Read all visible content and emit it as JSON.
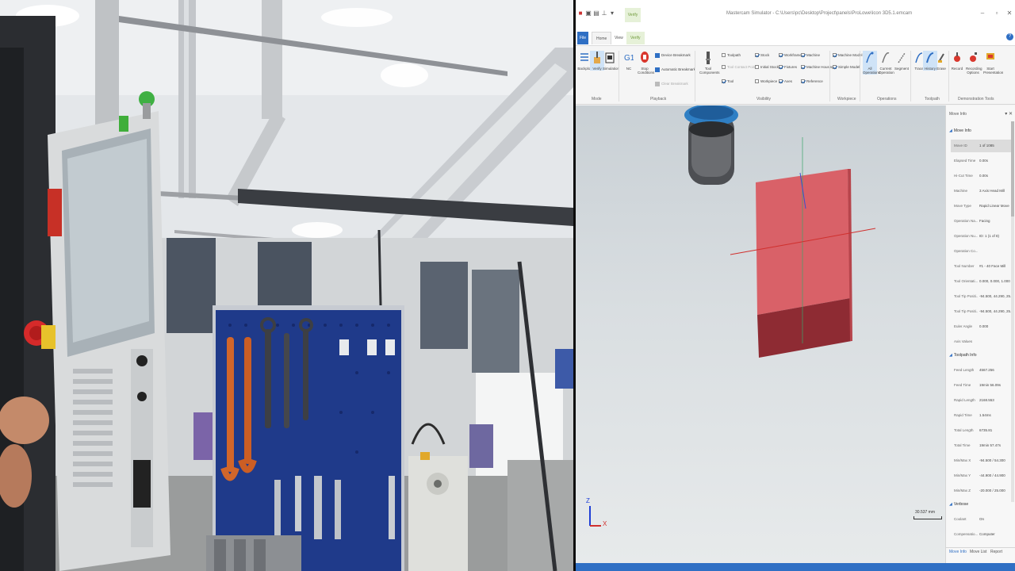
{
  "window": {
    "title": "Mastercam Simulator - C:\\Users\\pc\\Desktop\\Project\\panels\\ProLowe\\Icon 3D5.1.emcam",
    "context_tab": "Verify"
  },
  "tabs": {
    "file": "File",
    "home": "Home",
    "view": "View",
    "verify": "Verify"
  },
  "ribbon": {
    "mode": {
      "group": "Mode",
      "backplot": "Backplot",
      "verify": "Verify",
      "simulation": "Simulation"
    },
    "playback": {
      "group": "Playback",
      "nc": "NC",
      "stop_conditions": "Stop Conditions",
      "items": [
        "Device Breakmark",
        "Automatic Breakmark",
        "Clear Breakmark"
      ]
    },
    "tool_components": "Tool Components",
    "visibility": {
      "group": "Visibility",
      "rows": [
        [
          {
            "label": "Toolpath",
            "on": false
          },
          {
            "label": "Stock",
            "on": true
          },
          {
            "label": "Workframe",
            "on": true
          },
          {
            "label": "Machine",
            "on": true
          }
        ],
        [
          {
            "label": "Tool Contact Point",
            "on": false
          },
          {
            "label": "Initial Stock",
            "on": false
          },
          {
            "label": "Fixtures",
            "on": true
          },
          {
            "label": "Machine Housing",
            "on": true
          }
        ],
        [
          {
            "label": "Tool",
            "on": true
          },
          {
            "label": "Workpiece",
            "on": false
          },
          {
            "label": "Axes",
            "on": true
          },
          {
            "label": "Reference",
            "on": true
          }
        ]
      ]
    },
    "workpiece": {
      "group": "Workpiece",
      "items": [
        {
          "label": "Machine Model",
          "on": true
        },
        {
          "label": "Simple Model",
          "on": true
        }
      ]
    },
    "operations": {
      "group": "Operations",
      "all_ops": "All Operations",
      "current_op": "Current Operation",
      "segment": "Segment"
    },
    "toolpath": {
      "group": "Toolpath",
      "trace": "Trace",
      "history": "History",
      "erase": "Erase"
    },
    "demo": {
      "group": "Demonstration Tools",
      "record": "Record",
      "recording_options": "Recording Options",
      "start_presentation": "Start Presentation"
    }
  },
  "panel": {
    "title": "Move Info",
    "move_info": {
      "heading": "Move Info",
      "rows": [
        {
          "k": "Move ID",
          "v": "1 of 1085"
        },
        {
          "k": "Elapsed Time",
          "v": "0.00s"
        },
        {
          "k": "Hi-Cut Time",
          "v": "0.00s"
        },
        {
          "k": "Machine",
          "v": "3 Axis Head Mill"
        },
        {
          "k": "Move Type",
          "v": "Rapid Linear Move"
        },
        {
          "k": "Operation Na...",
          "v": "Facing"
        },
        {
          "k": "Operation Nu...",
          "v": "ID: 1 (1 of 8)"
        },
        {
          "k": "Operation Co...",
          "v": ""
        },
        {
          "k": "Tool Number",
          "v": "#1 - 40 Face Mill"
        },
        {
          "k": "Tool Orientati...",
          "v": "0.000, 0.000, 1.000"
        },
        {
          "k": "Tool Tip Positi...",
          "v": "-94.500, 44.290, 25."
        },
        {
          "k": "Tool Tip Positi...",
          "v": "-94.500, 44.290, 25."
        },
        {
          "k": "Euler Angle",
          "v": "0.000"
        },
        {
          "k": "Axis Values",
          "v": ""
        }
      ]
    },
    "toolpath_info": {
      "heading": "Toolpath Info",
      "rows": [
        {
          "k": "Feed Length",
          "v": "4567.256"
        },
        {
          "k": "Feed Time",
          "v": "19min 56.09s"
        },
        {
          "k": "Rapid Length",
          "v": "2168.553"
        },
        {
          "k": "Rapid Time",
          "v": "1.54ms"
        },
        {
          "k": "Total Length",
          "v": "6735.81"
        },
        {
          "k": "Total Time",
          "v": "19min 57.47s"
        },
        {
          "k": "Min/Max X",
          "v": "-94.500 / 54.300"
        },
        {
          "k": "Min/Max Y",
          "v": "-44.900 / 44.900"
        },
        {
          "k": "Min/Max Z",
          "v": "-20.000 / 25.000"
        }
      ]
    },
    "verbose": {
      "heading": "Verbose",
      "rows": [
        {
          "k": "Coolant",
          "v": "On"
        },
        {
          "k": "Compensatio...",
          "v": "Computer"
        }
      ]
    },
    "tabs": [
      "Move Info",
      "Move List",
      "Report"
    ]
  },
  "viewport": {
    "scale_label": "30.537 mm",
    "axis_z": "Z",
    "axis_x": "X"
  },
  "colors": {
    "accent": "#2f6fc4",
    "stock": "#d96168",
    "stock_side": "#8e2b33",
    "verify_green": "#6f9a3a"
  }
}
